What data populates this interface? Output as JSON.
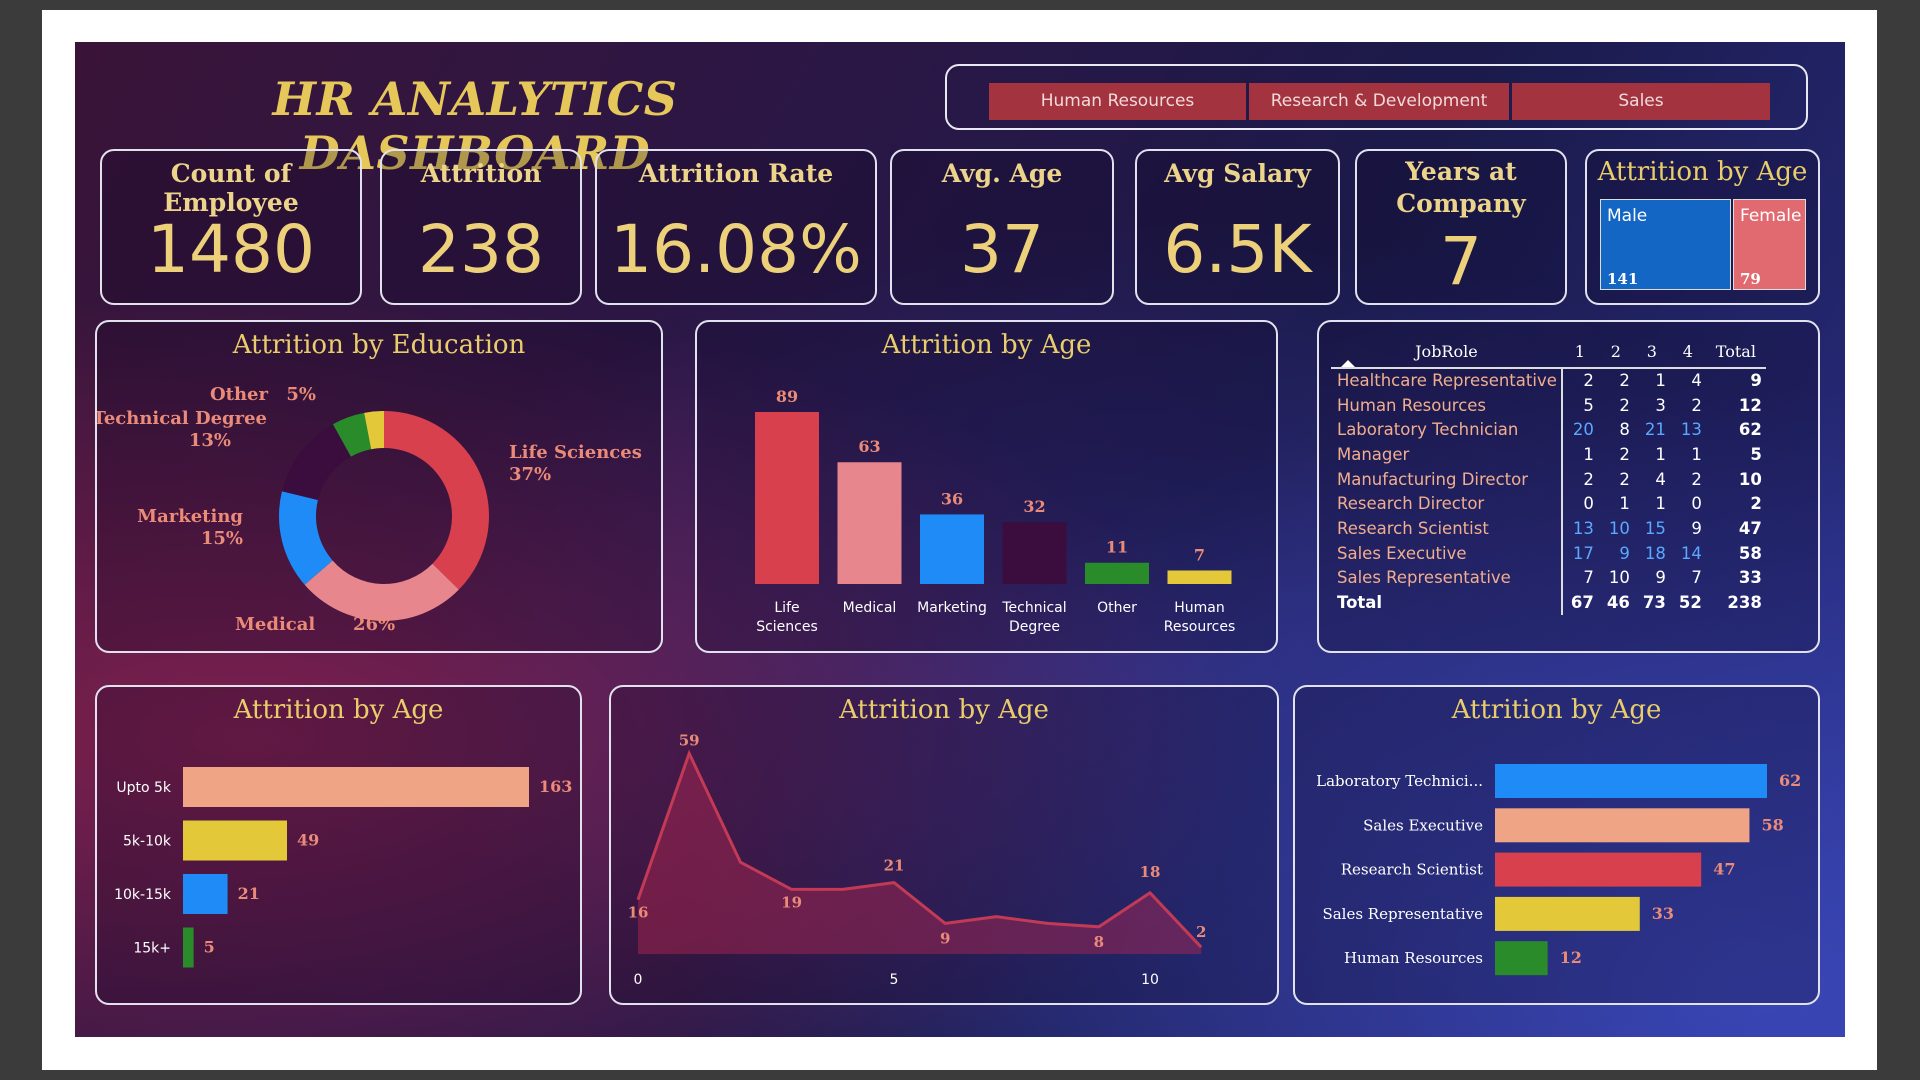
{
  "dashboard": {
    "title": "HR ANALYTICS DASHBOARD",
    "slicer": [
      "Human Resources",
      "Research & Development",
      "Sales"
    ]
  },
  "kpis": {
    "count": {
      "label": "Count of Employee",
      "value": "1480"
    },
    "attrition": {
      "label": "Attrition",
      "value": "238"
    },
    "rate": {
      "label": "Attrition Rate",
      "value": "16.08%"
    },
    "age": {
      "label": "Avg. Age",
      "value": "37"
    },
    "salary": {
      "label": "Avg Salary",
      "value": "6.5K"
    },
    "years": {
      "label_line1": "Years at",
      "label_line2": "Company",
      "value": "7"
    }
  },
  "colors": {
    "red": "#d9404d",
    "pink": "#e7868d",
    "blue": "#1e8bf7",
    "purple": "#3a0d3e",
    "green": "#2a8b2a",
    "yellow": "#e3c93a",
    "salmon": "#eea485",
    "gold": "#e9cd6a"
  },
  "chart_data": [
    {
      "id": "gender",
      "type": "bar",
      "title": "Attrition by Age",
      "categories": [
        "Male",
        "Female"
      ],
      "values": [
        141,
        79
      ]
    },
    {
      "id": "education_donut",
      "type": "pie",
      "title": "Attrition by Education",
      "slices": [
        {
          "name": "Life Sciences",
          "percent": 37,
          "label": "37%",
          "color": "#d9404d"
        },
        {
          "name": "Medical",
          "percent": 26,
          "label": "26%",
          "color": "#e7868d"
        },
        {
          "name": "Marketing",
          "percent": 15,
          "label": "15%",
          "color": "#1e8bf7"
        },
        {
          "name": "Technical Degree",
          "percent": 13,
          "label": "13%",
          "color": "#3a0d3e"
        },
        {
          "name": "Other",
          "percent": 5,
          "label": "5%",
          "color": "#2a8b2a"
        },
        {
          "name": "",
          "percent": 3,
          "label": "",
          "color": "#e3c93a"
        }
      ]
    },
    {
      "id": "education_bar",
      "type": "bar",
      "title": "Attrition by Age",
      "categories": [
        "Life Sciences",
        "Medical",
        "Marketing",
        "Technical Degree",
        "Other",
        "Human Resources"
      ],
      "values": [
        89,
        63,
        36,
        32,
        11,
        7
      ],
      "colors": [
        "#d9404d",
        "#e7868d",
        "#1e8bf7",
        "#3a0d3e",
        "#2a8b2a",
        "#e3c93a"
      ]
    },
    {
      "id": "jobrole_matrix",
      "type": "table",
      "columns": [
        "JobRole",
        "1",
        "2",
        "3",
        "4",
        "Total"
      ],
      "rows": [
        [
          "Healthcare Representative",
          "2",
          "2",
          "1",
          "4",
          "9"
        ],
        [
          "Human Resources",
          "5",
          "2",
          "3",
          "2",
          "12"
        ],
        [
          "Laboratory Technician",
          "20",
          "8",
          "21",
          "13",
          "62"
        ],
        [
          "Manager",
          "1",
          "2",
          "1",
          "1",
          "5"
        ],
        [
          "Manufacturing Director",
          "2",
          "2",
          "4",
          "2",
          "10"
        ],
        [
          "Research Director",
          "0",
          "1",
          "1",
          "0",
          "2"
        ],
        [
          "Research Scientist",
          "13",
          "10",
          "15",
          "9",
          "47"
        ],
        [
          "Sales Executive",
          "17",
          "9",
          "18",
          "14",
          "58"
        ],
        [
          "Sales Representative",
          "7",
          "10",
          "9",
          "7",
          "33"
        ]
      ],
      "total": [
        "Total",
        "67",
        "46",
        "73",
        "52",
        "238"
      ]
    },
    {
      "id": "salary_bar",
      "type": "bar",
      "title": "Attrition by Age",
      "categories": [
        "Upto 5k",
        "5k-10k",
        "10k-15k",
        "15k+"
      ],
      "values": [
        163,
        49,
        21,
        5
      ],
      "colors": [
        "#eea485",
        "#e3c93a",
        "#1e8bf7",
        "#2a8b2a"
      ]
    },
    {
      "id": "years_area",
      "type": "area",
      "title": "Attrition by Age",
      "x": [
        0,
        1,
        2,
        3,
        4,
        5,
        6,
        7,
        8,
        9,
        10,
        11
      ],
      "y": [
        16,
        59,
        27,
        19,
        19,
        21,
        9,
        11,
        9,
        8,
        18,
        2
      ],
      "point_labels": {
        "0": "16",
        "1": "59",
        "5": "21",
        "3": "19",
        "6": "9",
        "9": "8",
        "10": "18",
        "11": "2"
      },
      "xticks": [
        0,
        5,
        10
      ],
      "ylim": [
        0,
        60
      ]
    },
    {
      "id": "jobrole_bar",
      "type": "bar",
      "title": "Attrition by Age",
      "categories": [
        "Laboratory Technici...",
        "Sales Executive",
        "Research Scientist",
        "Sales Representative",
        "Human Resources"
      ],
      "values": [
        62,
        58,
        47,
        33,
        12
      ],
      "colors": [
        "#1e8bf7",
        "#eea485",
        "#d9404d",
        "#e3c93a",
        "#2a8b2a"
      ]
    }
  ]
}
